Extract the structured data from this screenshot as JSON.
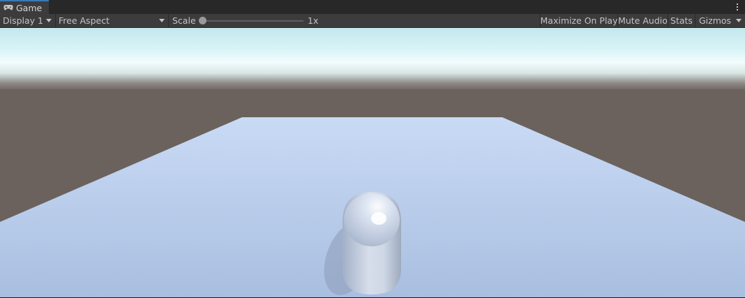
{
  "tab": {
    "title": "Game",
    "icon": "gamepad-icon"
  },
  "tab_menu_icon": "more-vertical-icon",
  "toolbar": {
    "display_label": "Display 1",
    "aspect_label": "Free Aspect",
    "scale_label": "Scale",
    "scale_value": "1x",
    "scale_level": 0,
    "maximize_label": "Maximize On Play",
    "mute_label": "Mute Audio",
    "stats_label": "Stats",
    "gizmos_label": "Gizmos"
  },
  "scene": {
    "sky_colors": [
      "#c5e9ef",
      "#f2fcff",
      "#6c635e"
    ],
    "ground_color": "#6b625d",
    "plane_color": "#bcccec",
    "capsule_color": "#d2dcec"
  }
}
